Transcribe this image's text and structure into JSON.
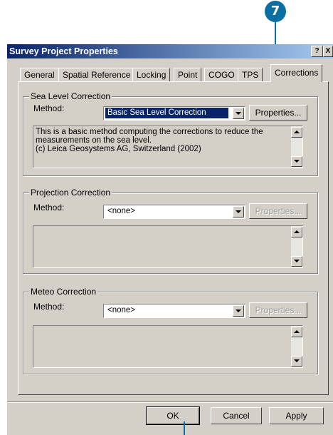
{
  "callout": {
    "number": "7"
  },
  "window": {
    "title": "Survey Project Properties",
    "help_label": "?",
    "close_label": "X"
  },
  "tabs": [
    {
      "label": "General"
    },
    {
      "label": "Spatial Reference"
    },
    {
      "label": "Locking"
    },
    {
      "label": "Point"
    },
    {
      "label": "COGO"
    },
    {
      "label": "TPS"
    },
    {
      "label": "Corrections"
    }
  ],
  "sea_level": {
    "title": "Sea Level Correction",
    "method_label": "Method:",
    "method_value": "Basic Sea Level Correction",
    "properties_label": "Properties...",
    "description": "This is a basic method computing the corrections to reduce the measurements on the sea level.\n(c) Leica Geosystems AG, Switzerland (2002)"
  },
  "projection": {
    "title": "Projection Correction",
    "method_label": "Method:",
    "method_value": "<none>",
    "properties_label": "Properties..."
  },
  "meteo": {
    "title": "Meteo Correction",
    "method_label": "Method:",
    "method_value": "<none>",
    "properties_label": "Properties..."
  },
  "footer": {
    "ok_label": "OK",
    "cancel_label": "Cancel",
    "apply_label": "Apply"
  },
  "colors": {
    "callout": "#0a6fa3",
    "titlebar_start": "#0a246a",
    "titlebar_end": "#a6caf0",
    "face": "#d4d0c8"
  }
}
